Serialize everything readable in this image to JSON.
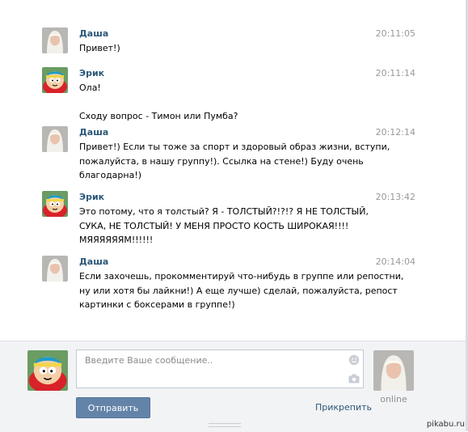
{
  "messages": [
    {
      "author": "Даша",
      "avatar": "blonde-girl-avatar",
      "time": "20:11:05",
      "lines": [
        "Привет!)"
      ]
    },
    {
      "author": "Эрик",
      "avatar": "cartman-avatar",
      "time": "20:11:14",
      "lines": [
        "Ола!",
        "",
        "Сходу вопрос - Тимон или Пумба?"
      ]
    },
    {
      "author": "Даша",
      "avatar": "blonde-girl-avatar",
      "time": "20:12:14",
      "lines": [
        "Привет!) Если ты тоже за спорт и здоровый образ жизни, вступи,",
        "пожалуйста, в нашу группу!). Ссылка на стене!) Буду очень",
        "благодарна!)"
      ]
    },
    {
      "author": "Эрик",
      "avatar": "cartman-avatar",
      "time": "20:13:42",
      "lines": [
        "Это потому, что я толстый? Я - ТОЛСТЫЙ?!?!? Я НЕ ТОЛСТЫЙ,",
        "СУКА, НЕ ТОЛСТЫЙ! У МЕНЯ ПРОСТО КОСТЬ ШИРОКАЯ!!!!",
        "МЯЯЯЯЯЯМ!!!!!!"
      ]
    },
    {
      "author": "Даша",
      "avatar": "blonde-girl-avatar",
      "time": "20:14:04",
      "lines": [
        "Если захочешь, прокомментируй что-нибудь в группе или репостни,",
        "ну или хотя бы лайкни!) А еще лучше) сделай, пожалуйста, репост",
        "картинки с боксерами в группе!)"
      ]
    }
  ],
  "composer": {
    "placeholder": "Введите Ваше сообщение..",
    "send_label": "Отправить",
    "attach_label": "Прикрепить",
    "peer_status": "online",
    "smile_icon": "smile-icon",
    "camera_icon": "camera-icon"
  },
  "watermark": "pikabu.ru",
  "colors": {
    "author": "#2b587a",
    "time": "#999999",
    "send_button": "#6383a8",
    "composer_bg": "#f2f3f5"
  }
}
